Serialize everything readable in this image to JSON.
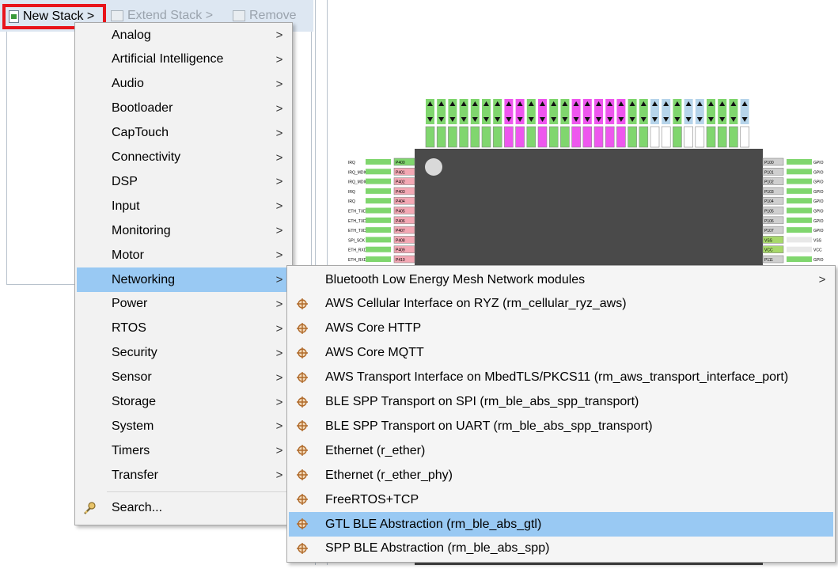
{
  "toolbar": {
    "new_stack": "New Stack >",
    "extend_stack": "Extend Stack >",
    "remove": "Remove"
  },
  "menu": {
    "items": [
      "Analog",
      "Artificial Intelligence",
      "Audio",
      "Bootloader",
      "CapTouch",
      "Connectivity",
      "DSP",
      "Input",
      "Monitoring",
      "Motor",
      "Networking",
      "Power",
      "RTOS",
      "Security",
      "Sensor",
      "Storage",
      "System",
      "Timers",
      "Transfer"
    ],
    "search": "Search...",
    "chevron": ">",
    "highlighted": "Networking"
  },
  "submenu": {
    "items": [
      "Bluetooth Low Energy Mesh Network modules",
      "AWS Cellular Interface on RYZ (rm_cellular_ryz_aws)",
      "AWS Core HTTP",
      "AWS Core MQTT",
      "AWS Transport Interface on MbedTLS/PKCS11 (rm_aws_transport_interface_port)",
      "BLE SPP Transport on SPI (rm_ble_abs_spp_transport)",
      "BLE SPP Transport on UART (rm_ble_abs_spp_transport)",
      "Ethernet (r_ether)",
      "Ethernet (r_ether_phy)",
      "FreeRTOS+TCP",
      "GTL BLE Abstraction (rm_ble_abs_gtl)",
      "SPP BLE Abstraction (rm_ble_abs_spp)"
    ],
    "highlighted": "GTL BLE Abstraction (rm_ble_abs_gtl)"
  },
  "colors": {
    "accent_highlight": "#99c9f3",
    "callout": "#e8141b",
    "pin_green": "#80d66e",
    "pin_magenta": "#ee57ee",
    "pin_pink": "#f3a8b4",
    "pin_blue": "#b6d4ea",
    "chip_body": "#4a4a4a"
  },
  "chip": {
    "left_pins": [
      "P400",
      "P401",
      "P402",
      "P403",
      "P404",
      "P405",
      "P406",
      "P407",
      "P408",
      "P409",
      "P410"
    ],
    "right_pins": [
      "P100",
      "P101",
      "P102",
      "P103",
      "P104",
      "P105",
      "P106",
      "P107",
      "VSS",
      "VCC",
      "P111"
    ],
    "left_sig": [
      "IRQ",
      "IRQ_MDIO",
      "IRQ_MDIO",
      "IRQ",
      "IRQ",
      "ETH_TXD",
      "ETH_TXD",
      "ETH_TXD",
      "SPI_SCK",
      "ETH_RXD",
      "ETH_RXD"
    ],
    "right_sig": [
      "GPIO",
      "GPIO",
      "GPIO",
      "GPIO",
      "GPIO",
      "GPIO",
      "GPIO",
      "GPIO",
      "VSS",
      "VCC",
      "GPIO"
    ]
  }
}
